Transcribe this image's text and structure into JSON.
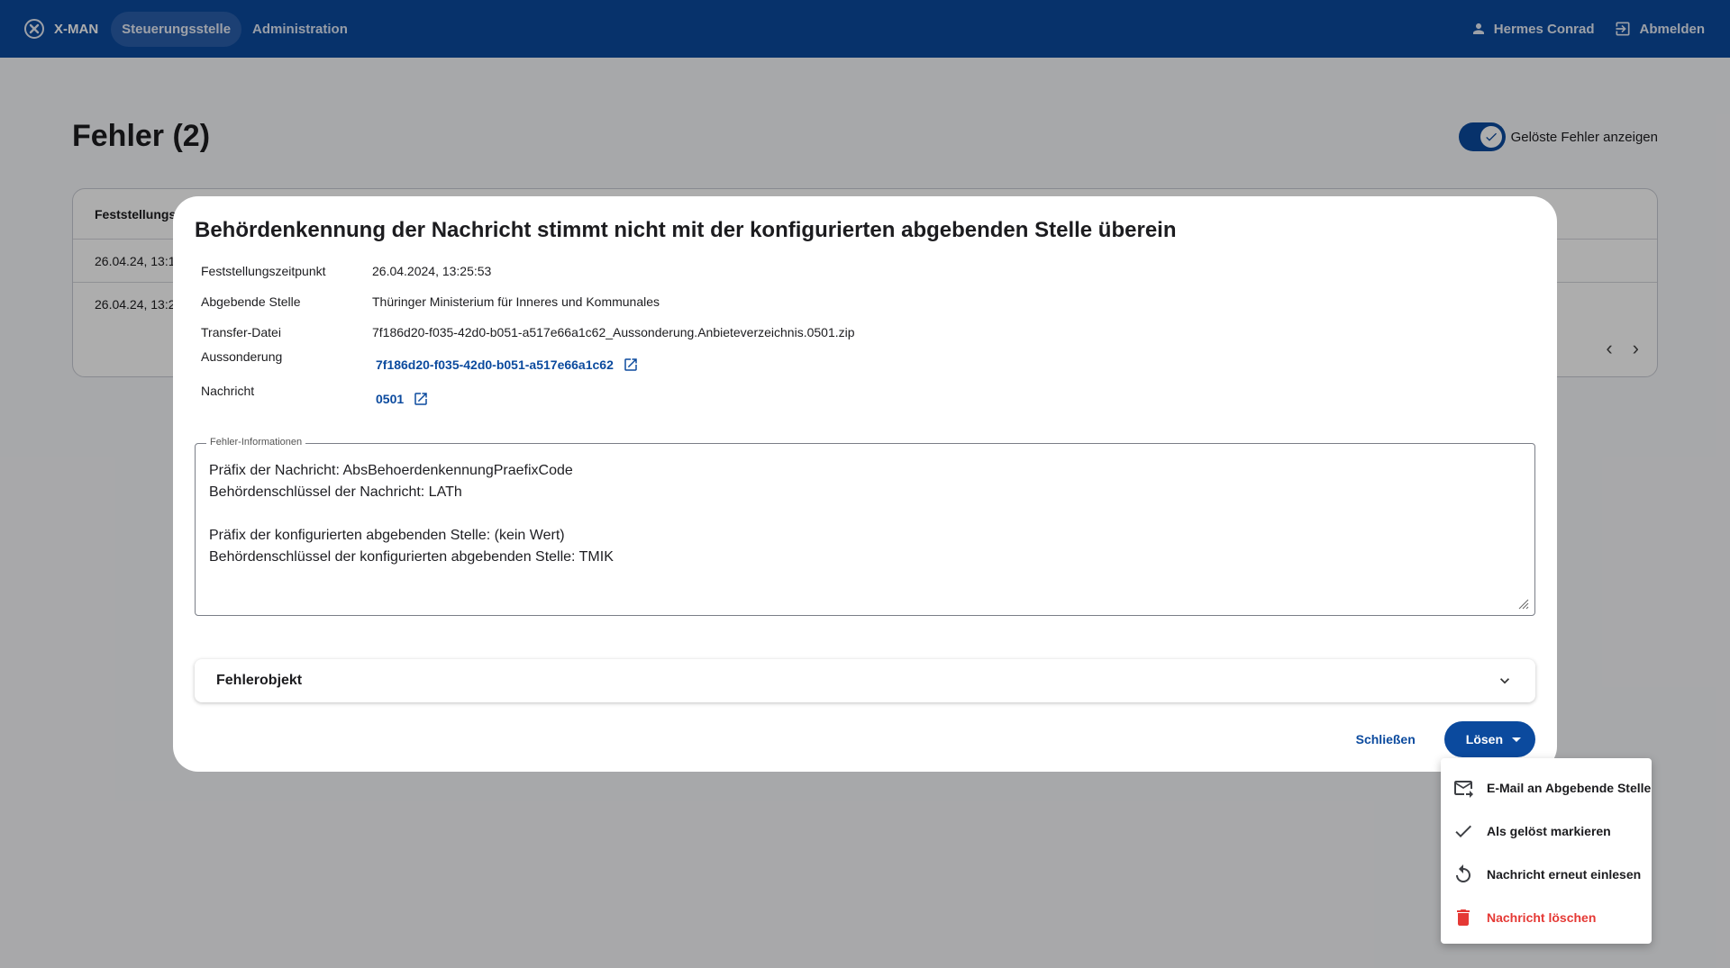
{
  "app": {
    "title": "X-MAN"
  },
  "nav": [
    {
      "label": "Steuerungsstelle",
      "active": true
    },
    {
      "label": "Administration",
      "active": false
    }
  ],
  "user": {
    "name": "Hermes Conrad",
    "logout_label": "Abmelden"
  },
  "page": {
    "title": "Fehler (2)",
    "toggle_label": "Gelöste Fehler anzeigen",
    "toggle_on": true,
    "table": {
      "header": "Feststellungsz",
      "rows": [
        "26.04.24, 13:1",
        "26.04.24, 13:2"
      ]
    }
  },
  "dialog": {
    "title": "Behördenkennung der Nachricht stimmt nicht mit der konfigurierten abgebenden Stelle überein",
    "details": [
      {
        "label": "Feststellungszeitpunkt",
        "value": "26.04.2024, 13:25:53"
      },
      {
        "label": "Abgebende Stelle",
        "value": "Thüringer Ministerium für Inneres und Kommunales"
      },
      {
        "label": "Transfer-Datei",
        "value": "7f186d20-f035-42d0-b051-a517e66a1c62_Aussonderung.Anbieteverzeichnis.0501.zip"
      },
      {
        "label": "Aussonderung",
        "value": "7f186d20-f035-42d0-b051-a517e66a1c62",
        "link": true
      },
      {
        "label": "Nachricht",
        "value": "0501",
        "link": true
      }
    ],
    "error_info_legend": "Fehler-Informationen",
    "error_info_text": "Präfix der Nachricht: AbsBehoerdenkennungPraefixCode\nBehördenschlüssel der Nachricht: LATh\n\nPräfix der konfigurierten abgebenden Stelle: (kein Wert)\nBehördenschlüssel der konfigurierten abgebenden Stelle: TMIK",
    "expansion_label": "Fehlerobjekt",
    "close_label": "Schließen",
    "solve_label": "Lösen"
  },
  "menu": [
    {
      "label": "E-Mail an Abgebende Stelle",
      "icon": "forward-email-icon",
      "danger": false
    },
    {
      "label": "Als gelöst markieren",
      "icon": "check-icon",
      "danger": false
    },
    {
      "label": "Nachricht erneut einlesen",
      "icon": "replay-icon",
      "danger": false
    },
    {
      "label": "Nachricht löschen",
      "icon": "delete-icon",
      "danger": true
    }
  ],
  "colors": {
    "primary": "#0b4a9e",
    "danger": "#e53935",
    "scrim": "rgba(0,0,0,0.32)"
  }
}
